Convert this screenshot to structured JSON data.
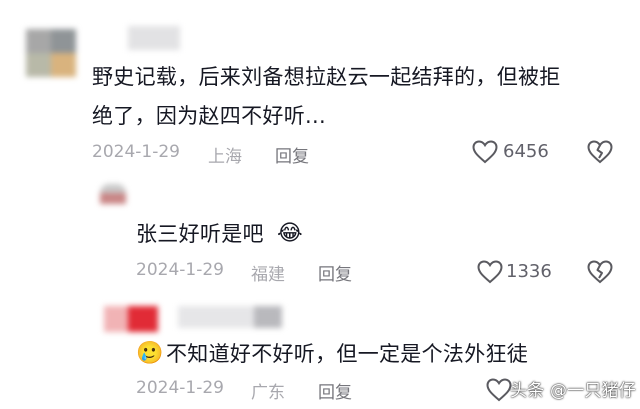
{
  "comments": [
    {
      "text_line1": "野史记载，后来刘备想拉赵云一起结拜的，但被拒",
      "text_line2": "绝了，因为赵四不好听...",
      "date": "2024-1-29",
      "location": "上海",
      "reply_label": "回复",
      "likes": "6456"
    },
    {
      "text": "张三好听是吧",
      "emoji": "😂",
      "date": "2024-1-29",
      "location": "福建",
      "reply_label": "回复",
      "likes": "1336"
    },
    {
      "emoji": "🥲",
      "text": "不知道好不好听，但一定是个法外狂徒",
      "date": "2024-1-29",
      "location": "广东",
      "reply_label": "回复"
    }
  ],
  "watermark": "头条 @一只猪仔",
  "colors": {
    "text": "#161823",
    "meta": "#a8a8ae",
    "icon": "#5a5a60",
    "avatar_gray": "#a7a7a7",
    "avatar_tan": "#d9b37e",
    "avatar_red": "#e12b36"
  },
  "icons": [
    "avatar-icon",
    "heart-icon",
    "dislike-heart-icon",
    "laugh-emoji-icon",
    "teary-emoji-icon"
  ]
}
